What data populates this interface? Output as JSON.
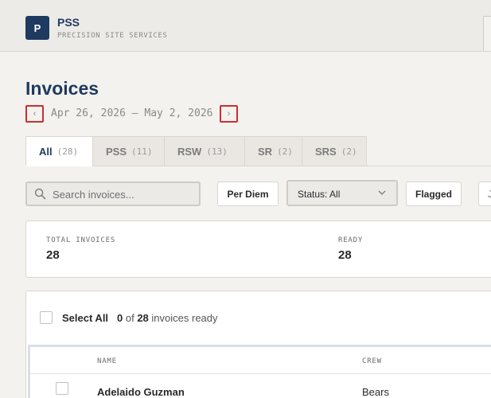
{
  "brand": {
    "logo_letter": "P",
    "name": "PSS",
    "subtitle": "PRECISION SITE SERVICES"
  },
  "page": {
    "title": "Invoices",
    "date_range": "Apr 26, 2026 – May 2, 2026",
    "prev_icon": "‹",
    "next_icon": "›"
  },
  "tabs": [
    {
      "label": "All",
      "count": "(28)",
      "active": true
    },
    {
      "label": "PSS",
      "count": "(11)",
      "active": false
    },
    {
      "label": "RSW",
      "count": "(13)",
      "active": false
    },
    {
      "label": "SR",
      "count": "(2)",
      "active": false
    },
    {
      "label": "SRS",
      "count": "(2)",
      "active": false
    }
  ],
  "toolbar": {
    "search_placeholder": "Search invoices...",
    "per_diem_label": "Per Diem",
    "status_select_value": "Status: All",
    "flagged_label": "Flagged",
    "partial_button_label": "J"
  },
  "stats": {
    "total_label": "TOTAL INVOICES",
    "total_value": "28",
    "ready_label": "READY",
    "ready_value": "28"
  },
  "table": {
    "select_all_label": "Select All",
    "ready_count": "0",
    "ready_of": "of",
    "ready_total": "28",
    "ready_suffix": "invoices ready",
    "columns": {
      "name": "NAME",
      "crew": "CREW"
    },
    "rows": [
      {
        "name": "Adelaido Guzman",
        "crew": "Bears"
      }
    ]
  },
  "colors": {
    "brand_navy": "#1e3a5f",
    "nav_highlight": "#cc2f2f",
    "background": "#f4f2ee"
  },
  "icons": {
    "search": "search-icon",
    "status_dropdown": "chevron-down-icon"
  }
}
